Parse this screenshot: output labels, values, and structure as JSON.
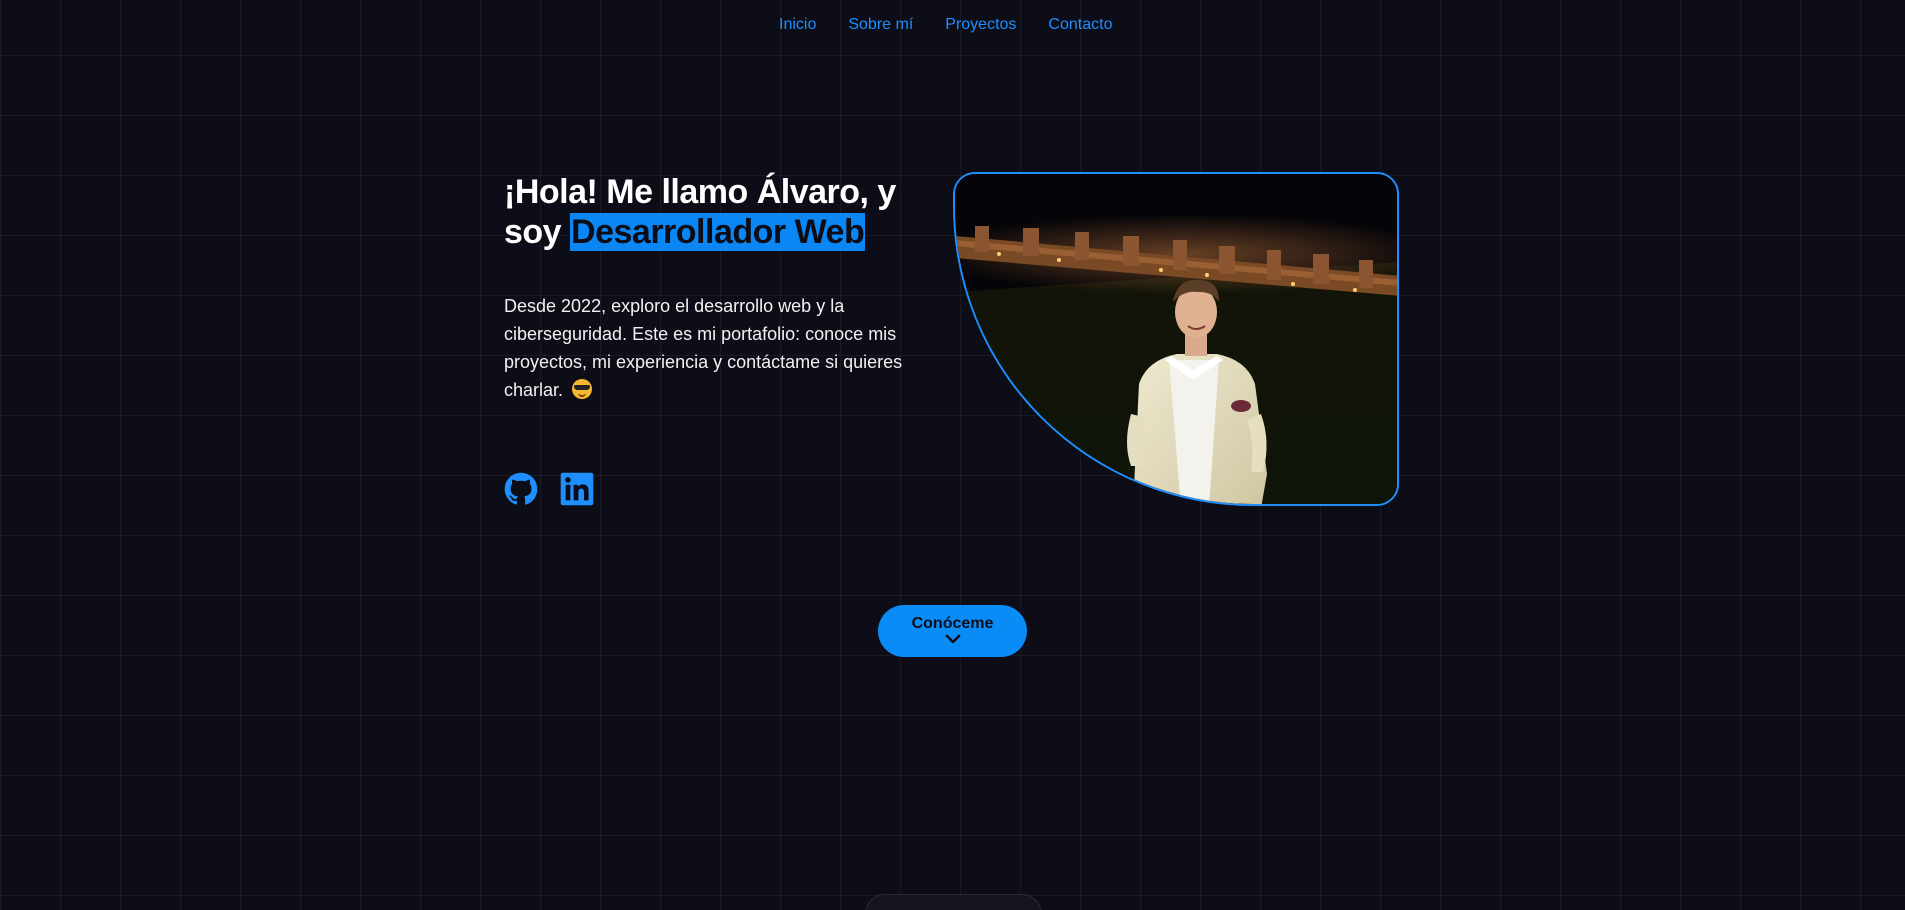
{
  "nav": {
    "items": [
      {
        "label": "Inicio"
      },
      {
        "label": "Sobre mí"
      },
      {
        "label": "Proyectos"
      },
      {
        "label": "Contacto"
      }
    ]
  },
  "hero": {
    "title_prefix": "¡Hola! Me llamo Álvaro, y soy ",
    "title_highlight": "Desarrollador Web",
    "intro": "Desde 2022, exploro el desarrollo web y la ciberseguridad. Este es mi portafolio: conoce mis proyectos, mi experiencia y contáctame si quieres charlar.",
    "emoji": "smiling-face-with-sunglasses"
  },
  "socials": [
    {
      "icon": "github-icon"
    },
    {
      "icon": "linkedin-icon"
    }
  ],
  "photo": {
    "icon": "profile-photo"
  },
  "cta": {
    "label": "Conóceme",
    "icon": "chevron-down-icon"
  },
  "colors": {
    "background": "#0c0d16",
    "accent": "#0a8cf7",
    "text": "#ffffff"
  }
}
